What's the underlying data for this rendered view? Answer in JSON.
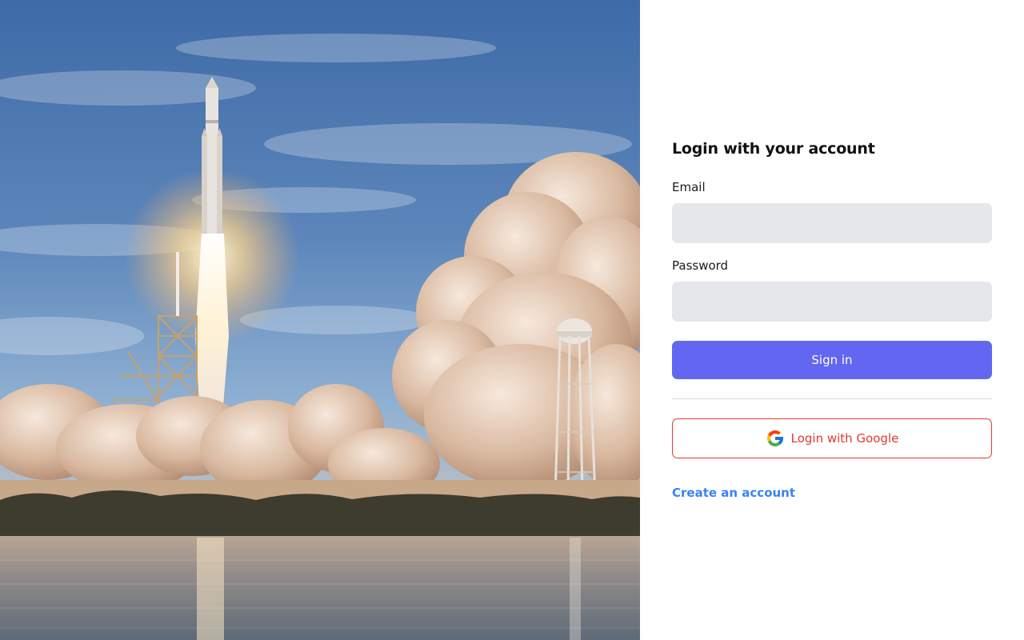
{
  "hero": {
    "image": "rocket-launch-photo"
  },
  "login": {
    "title": "Login with your account",
    "email_label": "Email",
    "email_value": "",
    "email_placeholder": "",
    "password_label": "Password",
    "password_value": "",
    "password_placeholder": "",
    "signin_label": "Sign in",
    "google_label": "Login with Google",
    "google_icon": "google-icon",
    "create_account_label": "Create an account"
  },
  "colors": {
    "primary": "#6366f1",
    "google_accent": "#e53935",
    "link": "#3b82f6",
    "input_bg": "#e6e7eb"
  }
}
